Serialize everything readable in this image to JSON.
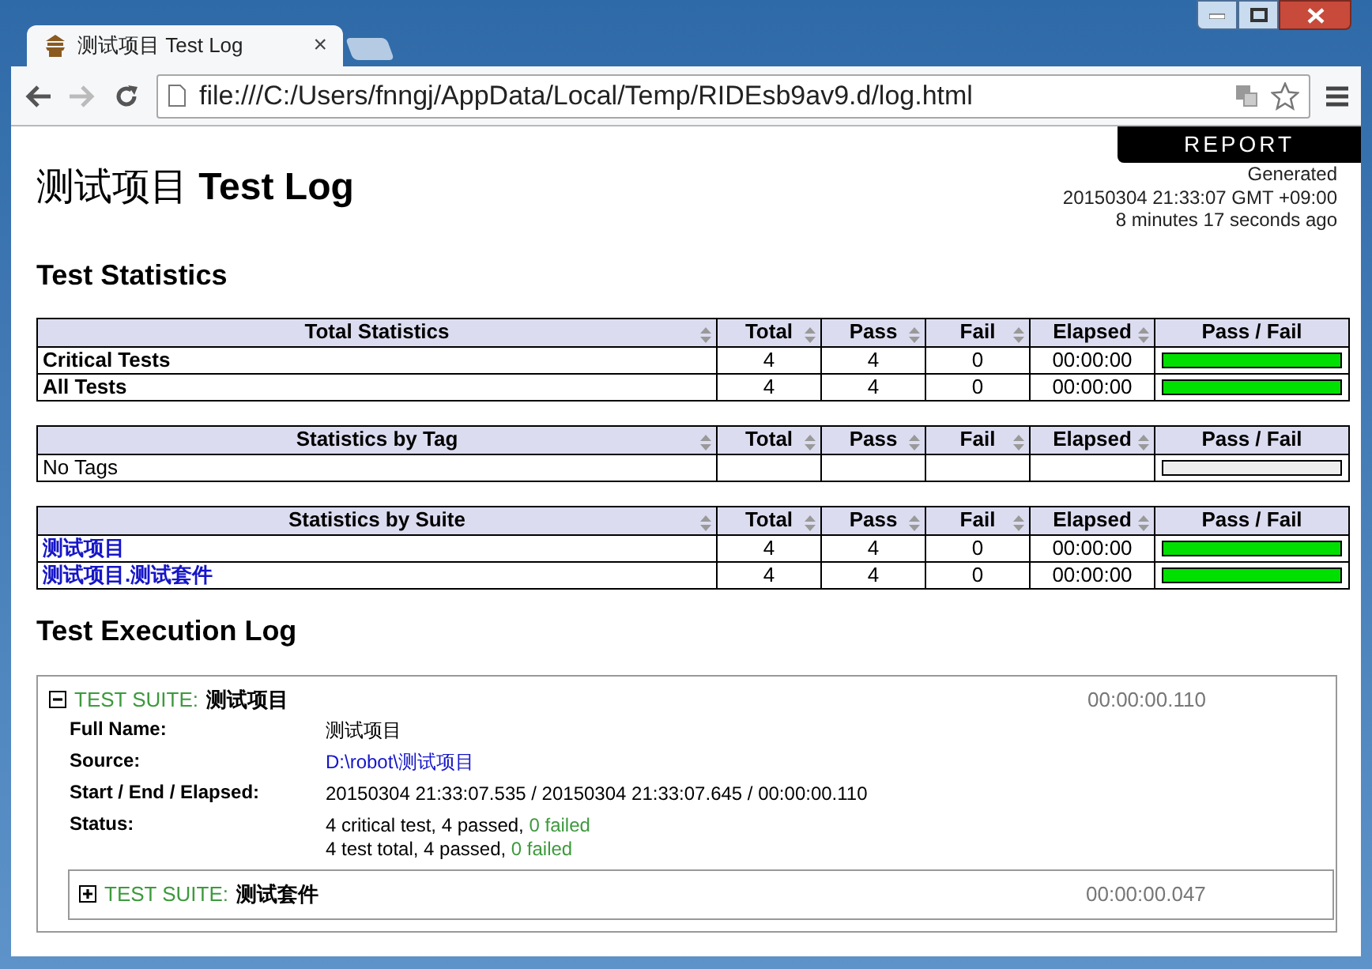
{
  "browser": {
    "tab_title": "测试项目 Test Log",
    "tab_close": "×",
    "address": "file:///C:/Users/fnngj/AppData/Local/Temp/RIDEsb9av9.d/log.html"
  },
  "report_button": "REPORT",
  "generated": [
    "Generated",
    "20150304 21:33:07 GMT +09:00",
    "8 minutes 17 seconds ago"
  ],
  "title": {
    "project": "测试项目",
    "suffix": "Test Log"
  },
  "statistics_heading": "Test Statistics",
  "tables": [
    {
      "columns": [
        {
          "label": "Total Statistics",
          "sortable": true
        },
        {
          "label": "Total",
          "sortable": true
        },
        {
          "label": "Pass",
          "sortable": true
        },
        {
          "label": "Fail",
          "sortable": true
        },
        {
          "label": "Elapsed",
          "sortable": true
        },
        {
          "label": "Pass / Fail",
          "sortable": false
        }
      ],
      "rows": [
        {
          "kind": "stat",
          "name": "Critical Tests",
          "total": "4",
          "pass": "4",
          "fail": "0",
          "elapsed": "00:00:00",
          "level": 1
        },
        {
          "kind": "stat",
          "name": "All Tests",
          "total": "4",
          "pass": "4",
          "fail": "0",
          "elapsed": "00:00:00",
          "level": 1
        }
      ]
    },
    {
      "columns": [
        {
          "label": "Statistics by Tag",
          "sortable": true
        },
        {
          "label": "Total",
          "sortable": true
        },
        {
          "label": "Pass",
          "sortable": true
        },
        {
          "label": "Fail",
          "sortable": true
        },
        {
          "label": "Elapsed",
          "sortable": true
        },
        {
          "label": "Pass / Fail",
          "sortable": false
        }
      ],
      "rows": [
        {
          "kind": "empty",
          "name": "No Tags"
        }
      ]
    },
    {
      "columns": [
        {
          "label": "Statistics by Suite",
          "sortable": true
        },
        {
          "label": "Total",
          "sortable": true
        },
        {
          "label": "Pass",
          "sortable": true
        },
        {
          "label": "Fail",
          "sortable": true
        },
        {
          "label": "Elapsed",
          "sortable": true
        },
        {
          "label": "Pass / Fail",
          "sortable": false
        }
      ],
      "rows": [
        {
          "kind": "link",
          "name": "测试项目",
          "total": "4",
          "pass": "4",
          "fail": "0",
          "elapsed": "00:00:00",
          "level": 1
        },
        {
          "kind": "link",
          "name": "测试项目.测试套件",
          "total": "4",
          "pass": "4",
          "fail": "0",
          "elapsed": "00:00:00",
          "level": 1
        }
      ]
    }
  ],
  "execution_heading": "Test Execution Log",
  "suite": {
    "expanded": true,
    "label": "TEST SUITE:",
    "name": "测试项目",
    "elapsed": "00:00:00.110",
    "details": [
      {
        "kind": "text",
        "key": "Full Name:",
        "value": "测试项目"
      },
      {
        "kind": "link",
        "key": "Source:",
        "value": "D:\\robot\\测试项目"
      },
      {
        "kind": "text",
        "key": "Start / End / Elapsed:",
        "value": "20150304 21:33:07.535 / 20150304 21:33:07.645 / 00:00:00.110"
      },
      {
        "kind": "status",
        "key": "Status:",
        "lines": [
          {
            "text": "4 critical test, 4 passed, ",
            "failed": "0 failed"
          },
          {
            "text": "4 test total, 4 passed, ",
            "failed": "0 failed"
          }
        ]
      }
    ],
    "children": [
      {
        "expanded": false,
        "label": "TEST SUITE:",
        "name": "测试套件",
        "elapsed": "00:00:00.047"
      }
    ]
  }
}
